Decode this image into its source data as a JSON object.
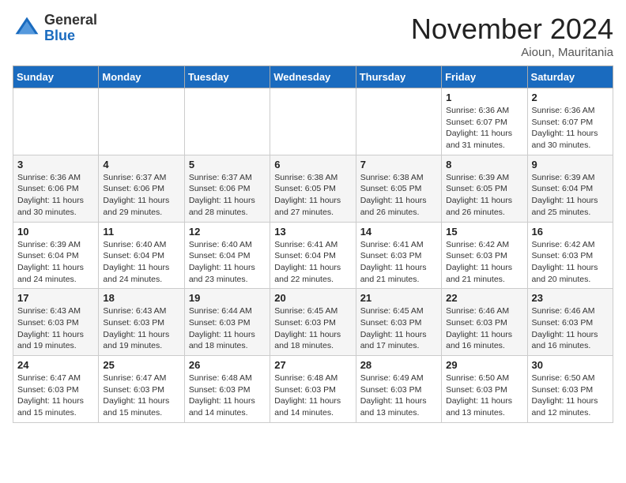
{
  "header": {
    "logo_line1": "General",
    "logo_line2": "Blue",
    "month_title": "November 2024",
    "location": "Aioun, Mauritania"
  },
  "weekdays": [
    "Sunday",
    "Monday",
    "Tuesday",
    "Wednesday",
    "Thursday",
    "Friday",
    "Saturday"
  ],
  "weeks": [
    [
      {
        "day": "",
        "info": ""
      },
      {
        "day": "",
        "info": ""
      },
      {
        "day": "",
        "info": ""
      },
      {
        "day": "",
        "info": ""
      },
      {
        "day": "",
        "info": ""
      },
      {
        "day": "1",
        "info": "Sunrise: 6:36 AM\nSunset: 6:07 PM\nDaylight: 11 hours\nand 31 minutes."
      },
      {
        "day": "2",
        "info": "Sunrise: 6:36 AM\nSunset: 6:07 PM\nDaylight: 11 hours\nand 30 minutes."
      }
    ],
    [
      {
        "day": "3",
        "info": "Sunrise: 6:36 AM\nSunset: 6:06 PM\nDaylight: 11 hours\nand 30 minutes."
      },
      {
        "day": "4",
        "info": "Sunrise: 6:37 AM\nSunset: 6:06 PM\nDaylight: 11 hours\nand 29 minutes."
      },
      {
        "day": "5",
        "info": "Sunrise: 6:37 AM\nSunset: 6:06 PM\nDaylight: 11 hours\nand 28 minutes."
      },
      {
        "day": "6",
        "info": "Sunrise: 6:38 AM\nSunset: 6:05 PM\nDaylight: 11 hours\nand 27 minutes."
      },
      {
        "day": "7",
        "info": "Sunrise: 6:38 AM\nSunset: 6:05 PM\nDaylight: 11 hours\nand 26 minutes."
      },
      {
        "day": "8",
        "info": "Sunrise: 6:39 AM\nSunset: 6:05 PM\nDaylight: 11 hours\nand 26 minutes."
      },
      {
        "day": "9",
        "info": "Sunrise: 6:39 AM\nSunset: 6:04 PM\nDaylight: 11 hours\nand 25 minutes."
      }
    ],
    [
      {
        "day": "10",
        "info": "Sunrise: 6:39 AM\nSunset: 6:04 PM\nDaylight: 11 hours\nand 24 minutes."
      },
      {
        "day": "11",
        "info": "Sunrise: 6:40 AM\nSunset: 6:04 PM\nDaylight: 11 hours\nand 24 minutes."
      },
      {
        "day": "12",
        "info": "Sunrise: 6:40 AM\nSunset: 6:04 PM\nDaylight: 11 hours\nand 23 minutes."
      },
      {
        "day": "13",
        "info": "Sunrise: 6:41 AM\nSunset: 6:04 PM\nDaylight: 11 hours\nand 22 minutes."
      },
      {
        "day": "14",
        "info": "Sunrise: 6:41 AM\nSunset: 6:03 PM\nDaylight: 11 hours\nand 21 minutes."
      },
      {
        "day": "15",
        "info": "Sunrise: 6:42 AM\nSunset: 6:03 PM\nDaylight: 11 hours\nand 21 minutes."
      },
      {
        "day": "16",
        "info": "Sunrise: 6:42 AM\nSunset: 6:03 PM\nDaylight: 11 hours\nand 20 minutes."
      }
    ],
    [
      {
        "day": "17",
        "info": "Sunrise: 6:43 AM\nSunset: 6:03 PM\nDaylight: 11 hours\nand 19 minutes."
      },
      {
        "day": "18",
        "info": "Sunrise: 6:43 AM\nSunset: 6:03 PM\nDaylight: 11 hours\nand 19 minutes."
      },
      {
        "day": "19",
        "info": "Sunrise: 6:44 AM\nSunset: 6:03 PM\nDaylight: 11 hours\nand 18 minutes."
      },
      {
        "day": "20",
        "info": "Sunrise: 6:45 AM\nSunset: 6:03 PM\nDaylight: 11 hours\nand 18 minutes."
      },
      {
        "day": "21",
        "info": "Sunrise: 6:45 AM\nSunset: 6:03 PM\nDaylight: 11 hours\nand 17 minutes."
      },
      {
        "day": "22",
        "info": "Sunrise: 6:46 AM\nSunset: 6:03 PM\nDaylight: 11 hours\nand 16 minutes."
      },
      {
        "day": "23",
        "info": "Sunrise: 6:46 AM\nSunset: 6:03 PM\nDaylight: 11 hours\nand 16 minutes."
      }
    ],
    [
      {
        "day": "24",
        "info": "Sunrise: 6:47 AM\nSunset: 6:03 PM\nDaylight: 11 hours\nand 15 minutes."
      },
      {
        "day": "25",
        "info": "Sunrise: 6:47 AM\nSunset: 6:03 PM\nDaylight: 11 hours\nand 15 minutes."
      },
      {
        "day": "26",
        "info": "Sunrise: 6:48 AM\nSunset: 6:03 PM\nDaylight: 11 hours\nand 14 minutes."
      },
      {
        "day": "27",
        "info": "Sunrise: 6:48 AM\nSunset: 6:03 PM\nDaylight: 11 hours\nand 14 minutes."
      },
      {
        "day": "28",
        "info": "Sunrise: 6:49 AM\nSunset: 6:03 PM\nDaylight: 11 hours\nand 13 minutes."
      },
      {
        "day": "29",
        "info": "Sunrise: 6:50 AM\nSunset: 6:03 PM\nDaylight: 11 hours\nand 13 minutes."
      },
      {
        "day": "30",
        "info": "Sunrise: 6:50 AM\nSunset: 6:03 PM\nDaylight: 11 hours\nand 12 minutes."
      }
    ]
  ]
}
